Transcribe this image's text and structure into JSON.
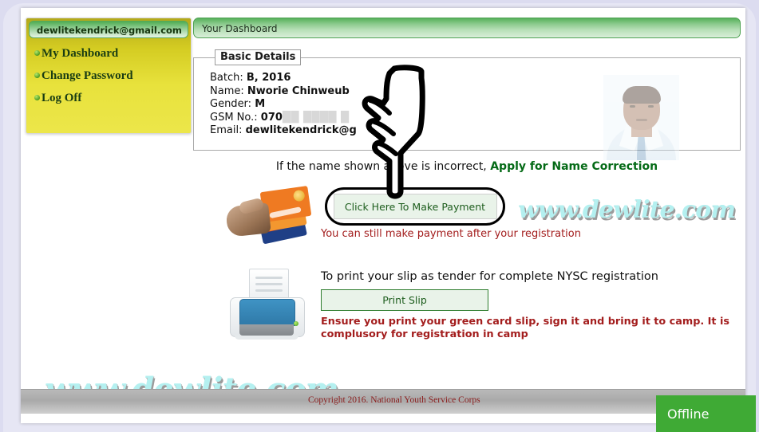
{
  "sidebar": {
    "account_email": "dewlitekendrick@gmail.com",
    "items": [
      {
        "label": "My Dashboard",
        "icon": "bullet-icon"
      },
      {
        "label": "Change Password",
        "icon": "bullet-icon"
      },
      {
        "label": "Log Off",
        "icon": "bullet-icon"
      }
    ]
  },
  "main": {
    "dashboard_title": "Your Dashboard",
    "details": {
      "legend": "Basic Details",
      "batch_label": "Batch:",
      "batch_value": "B, 2016",
      "name_label": "Name:",
      "name_value": "Nworie Chinweub",
      "gender_label": "Gender:",
      "gender_value": "M",
      "gsm_label": "GSM No.:",
      "gsm_value": "070",
      "gsm_masked": "██ ████ █",
      "email_label": "Email:",
      "email_value": "dewlitekendrick@g"
    },
    "name_note_text": "If the name shown above is incorrect, ",
    "name_correction_link": "Apply for Name Correction",
    "payment": {
      "button_label": "Click Here To Make Payment",
      "note": "You can still make payment after your registration",
      "icon": "credit-cards-icon"
    },
    "print": {
      "title": "To print your slip as tender for complete NYSC registration",
      "button_label": "Print Slip",
      "warning": "Ensure you print your green card slip, sign it and bring it to camp. It is complusory for registration in camp",
      "icon": "printer-icon"
    },
    "photo_alt": "passport-photo"
  },
  "watermark": {
    "right": "www.dewlite.com",
    "left": "www.dewlite.com"
  },
  "footer": {
    "copyright": "Copyright 2016. National Youth Service Corps"
  },
  "offline_widget": {
    "label": "Offline"
  },
  "colors": {
    "accent_green": "#3faa35",
    "link_green": "#046a16",
    "warning_red": "#a31d1d",
    "sidebar_yellow": "#ece64a",
    "watermark_cyan": "#b4f0f0"
  }
}
